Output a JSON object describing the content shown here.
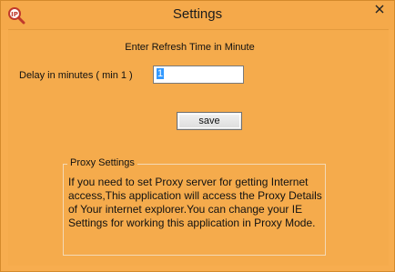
{
  "window": {
    "title": "Settings"
  },
  "icons": {
    "app": "magnifier-ip-icon",
    "close": "close-icon"
  },
  "settings": {
    "heading": "Enter Refresh Time in Minute",
    "delay_label": "Delay in minutes ( min 1 )",
    "delay_value": "1",
    "save_label": "save"
  },
  "proxy": {
    "legend": "Proxy Settings",
    "description": "If you need to set Proxy server for getting Internet access,This application will access the Proxy Details of Your internet explorer.You can change your IE Settings for working this application in Proxy Mode."
  },
  "colors": {
    "background": "#f5ab4c",
    "close_red": "#c0392b"
  }
}
